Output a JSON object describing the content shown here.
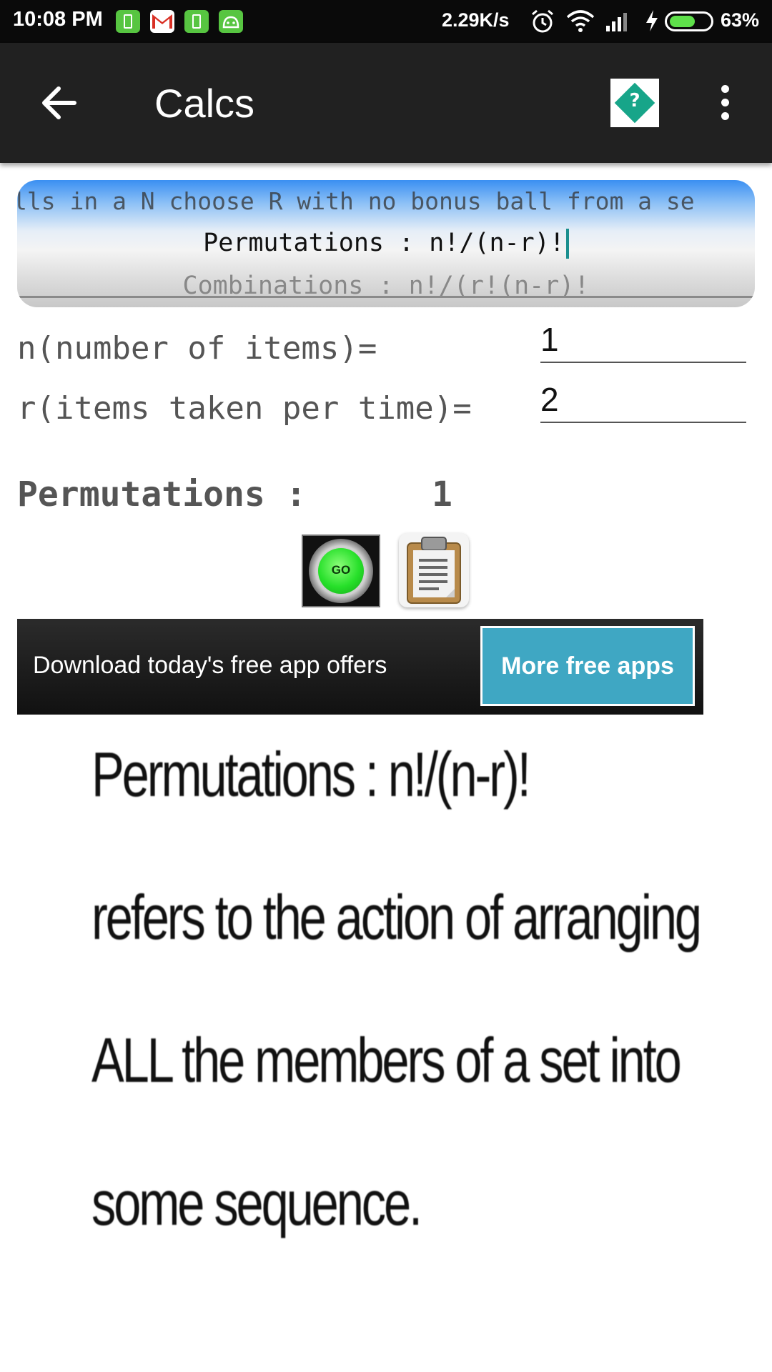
{
  "status_bar": {
    "time": "10:08 PM",
    "network_speed": "2.29K/s",
    "battery_percent": "63%",
    "battery_level": 0.63,
    "notification_icons": [
      "battery-notif-icon",
      "gmail-icon",
      "battery-notif-icon",
      "android-icon"
    ]
  },
  "app_bar": {
    "title": "Calcs",
    "back_icon": "arrow-left-icon",
    "help_icon": "help-diamond-icon",
    "help_glyph": "?",
    "overflow_icon": "more-vertical-icon"
  },
  "picker": {
    "items": [
      "lls in a N choose R with no bonus ball from a se",
      "Permutations : n!/(n-r)!",
      "Combinations : n!/(r!(n-r)!"
    ],
    "selected_index": 1
  },
  "inputs": {
    "n_label": "n(number of items)=",
    "n_value": "1",
    "r_label": "r(items taken per time)=",
    "r_value": "2"
  },
  "result": {
    "label": "Permutations :",
    "value": "1"
  },
  "buttons": {
    "go_label": "GO",
    "clipboard_icon": "clipboard-icon"
  },
  "ad": {
    "text": "Download today's free app offers",
    "button_label": "More free apps",
    "button_color": "#3fa7c3"
  },
  "description": {
    "lines": [
      "Permutations : n!/(n-r)!",
      "refers to the action of arranging",
      "ALL the members of a set into",
      "some sequence."
    ]
  },
  "colors": {
    "status_bar_bg": "#0a0a0a",
    "app_bar_bg": "#212121",
    "accent_green": "#57c541"
  }
}
